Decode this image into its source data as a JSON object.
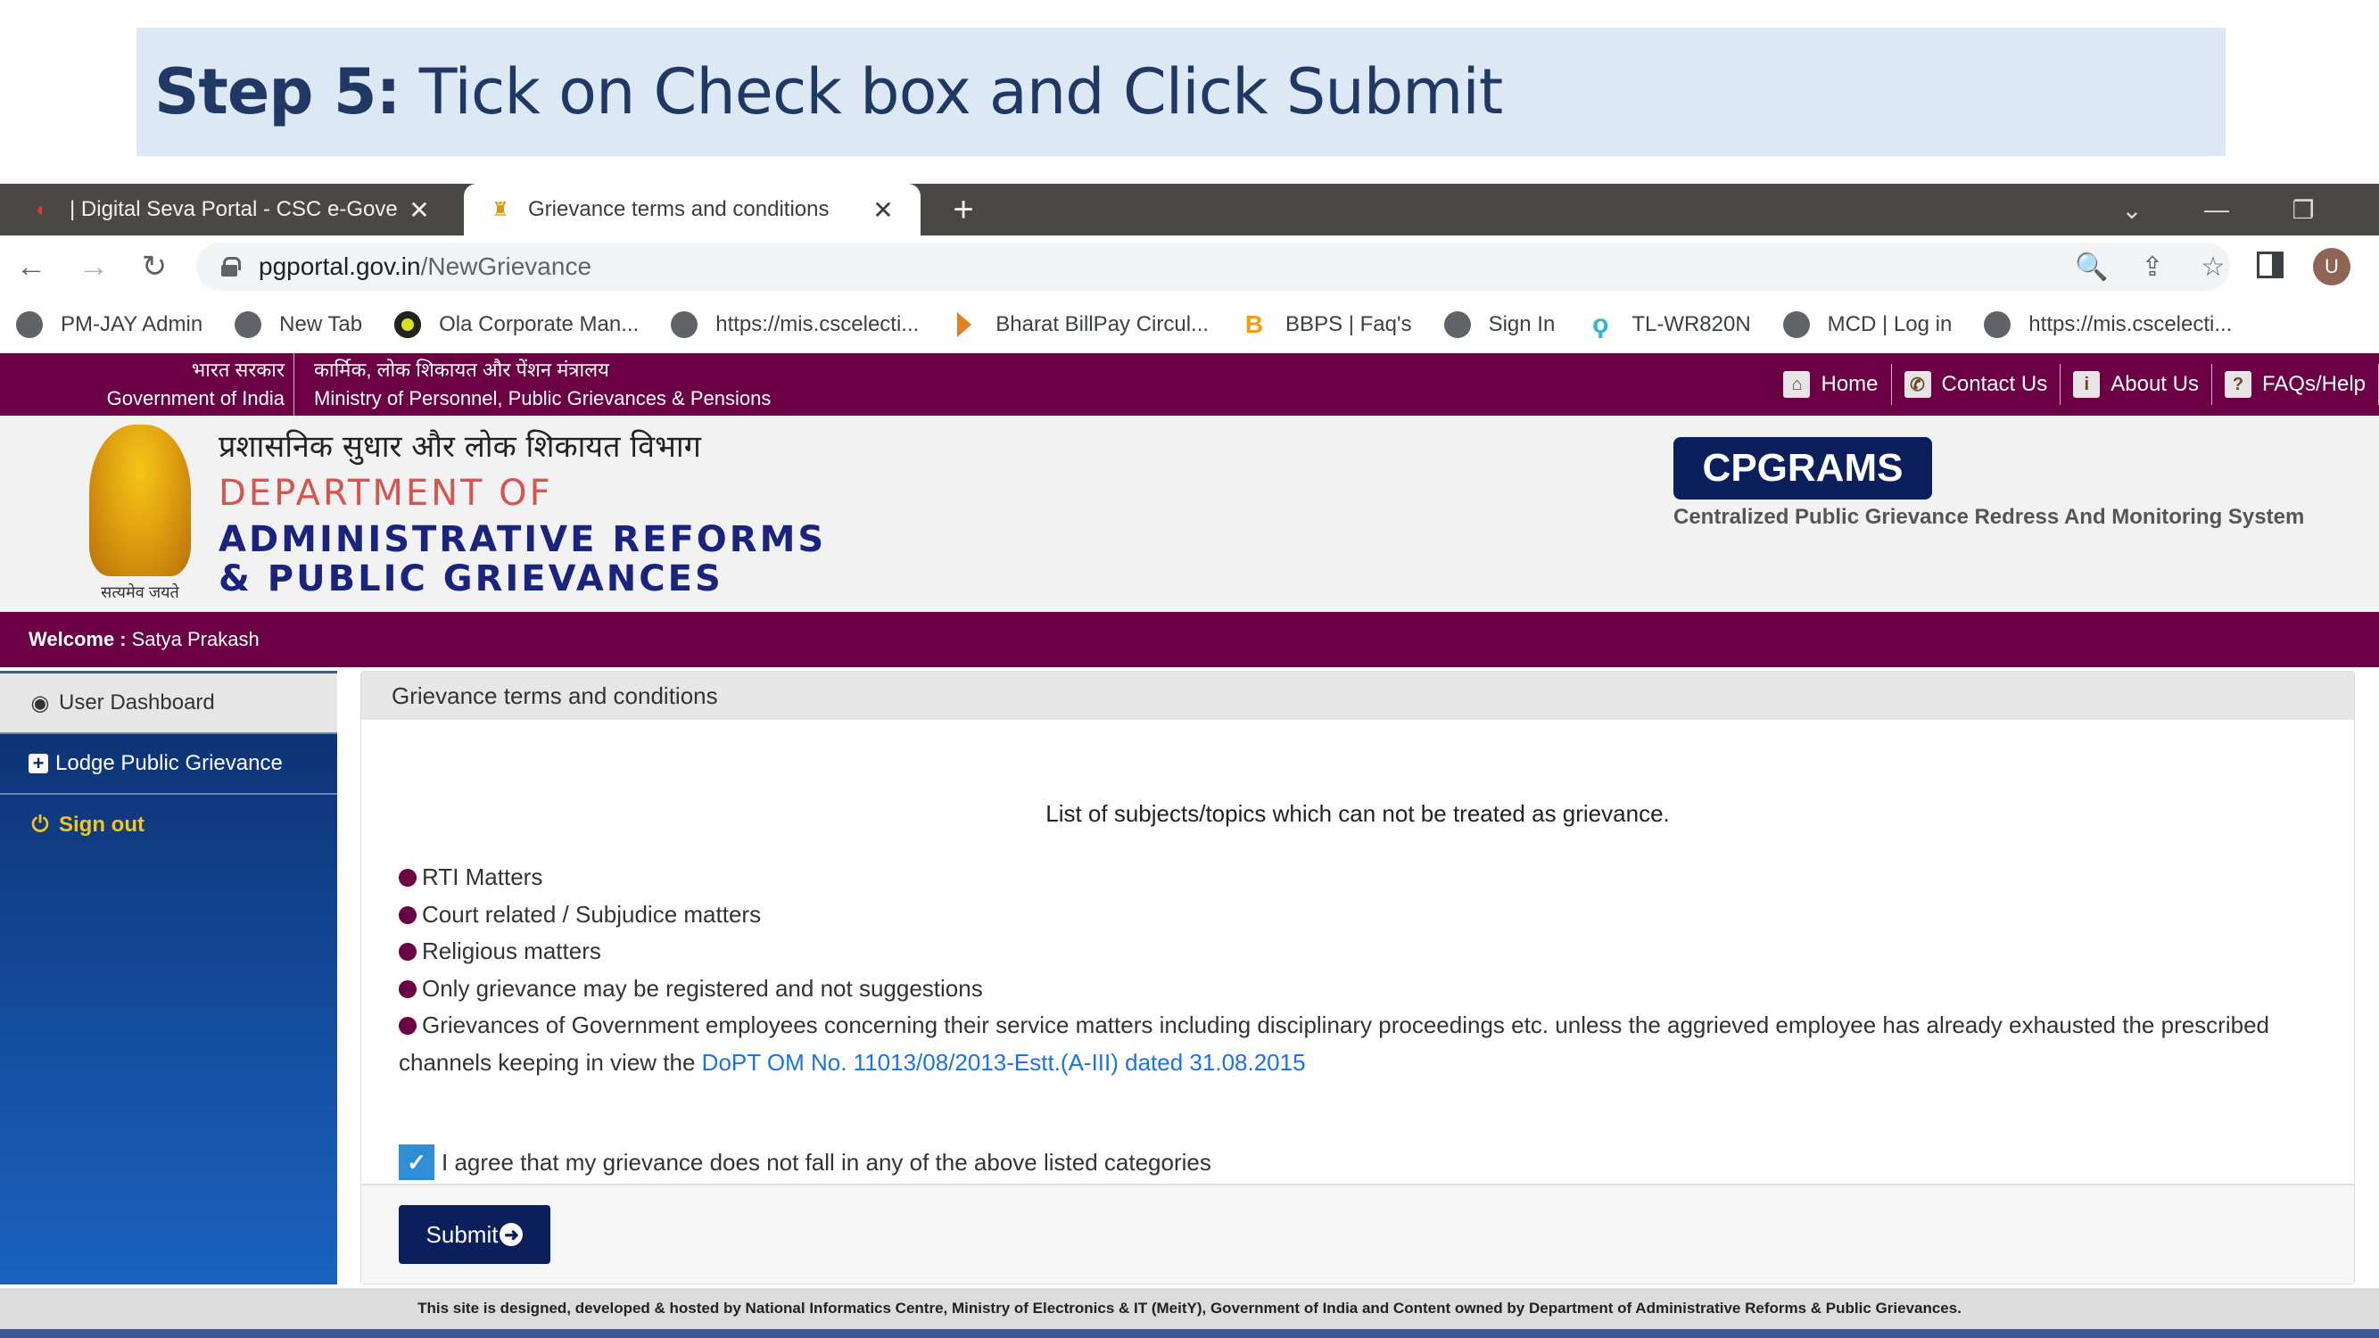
{
  "slide": {
    "step_label": "Step 5:",
    "step_text": " Tick on Check box and Click Submit"
  },
  "browser": {
    "tabs": [
      {
        "title": "| Digital Seva Portal - CSC e-Gove",
        "close": "✕",
        "active": false
      },
      {
        "title": "Grievance terms and conditions",
        "close": "✕",
        "active": true
      }
    ],
    "new_tab": "+",
    "window_controls": {
      "dropdown": "⌄",
      "minimize": "—",
      "restore": "❐"
    },
    "url_host": "pgportal.gov.in",
    "url_path": "/NewGrievance",
    "nav": {
      "back": "←",
      "forward": "→",
      "reload": "↻"
    },
    "omnibox_icons": {
      "zoom": "🔍",
      "share": "⇪",
      "star": "☆"
    },
    "profile_initial": "U",
    "bookmarks": [
      {
        "label": "PM-JAY Admin",
        "icon": "globe"
      },
      {
        "label": "New Tab",
        "icon": "globe"
      },
      {
        "label": "Ola Corporate Man...",
        "icon": "ola"
      },
      {
        "label": "https://mis.cscelecti...",
        "icon": "globe"
      },
      {
        "label": "Bharat BillPay Circul...",
        "icon": "bharat"
      },
      {
        "label": "BBPS | Faq's",
        "icon": "bbps"
      },
      {
        "label": "Sign In",
        "icon": "globe"
      },
      {
        "label": "TL-WR820N",
        "icon": "tp-link"
      },
      {
        "label": "MCD | Log in",
        "icon": "globe"
      },
      {
        "label": "https://mis.cscelecti...",
        "icon": "globe"
      }
    ]
  },
  "portal": {
    "gov_hindi": "भारत सरकार",
    "gov_english": "Government of India",
    "ministry_hindi": "कार्मिक, लोक शिकायत और पेंशन मंत्रालय",
    "ministry_english": "Ministry of Personnel, Public Grievances & Pensions",
    "top_links": [
      {
        "label": "Home",
        "icon": "home-icon",
        "glyph": "⌂"
      },
      {
        "label": "Contact Us",
        "icon": "phone-icon",
        "glyph": "✆"
      },
      {
        "label": "About Us",
        "icon": "info-icon",
        "glyph": "i"
      },
      {
        "label": "FAQs/Help",
        "icon": "question-icon",
        "glyph": "?"
      }
    ],
    "dept_hindi": "प्रशासनिक सुधार और लोक शिकायत विभाग",
    "dept_line1": "DEPARTMENT OF",
    "dept_line2": "ADMINISTRATIVE REFORMS",
    "dept_line3": "& PUBLIC GRIEVANCES",
    "emblem_motto": "सत्यमेव जयते",
    "brand": "CPGRAMS",
    "brand_sub": "Centralized Public Grievance Redress And Monitoring System",
    "welcome_label": "Welcome :",
    "welcome_user": "Satya Prakash",
    "sidebar": [
      {
        "label": "User Dashboard",
        "glyph": "◉"
      },
      {
        "label": "Lodge Public Grievance",
        "glyph": "+"
      },
      {
        "label": "Sign out",
        "glyph": "⏻"
      }
    ],
    "panel_title": "Grievance terms and conditions",
    "list_title": "List of subjects/topics which can not be treated as grievance.",
    "terms": [
      "RTI Matters",
      "Court related / Subjudice matters",
      "Religious matters",
      "Only grievance may be registered and not suggestions",
      "Grievances of Government employees concerning their service matters including disciplinary proceedings etc. unless the aggrieved employee has already exhausted the prescribed channels keeping in view the "
    ],
    "dopt_link": "DoPT OM No. 11013/08/2013-Estt.(A-III) dated 31.08.2015",
    "agree_text": "I agree that my grievance does not fall in any of the above listed categories",
    "agree_checked": true,
    "checkmark": "✓",
    "submit_label": "Submit",
    "submit_glyph": "➜",
    "footer": "This site is designed, developed & hosted by National Informatics Centre, Ministry of Electronics & IT (MeitY), Government of India and Content owned by Department of Administrative Reforms & Public Grievances."
  },
  "colors": {
    "portal_maroon": "#6b0044",
    "brand_navy": "#0b1f5c",
    "link_blue": "#1a73e8",
    "checkbox_blue": "#2e8fd6",
    "signout_yellow": "#f5c518"
  }
}
